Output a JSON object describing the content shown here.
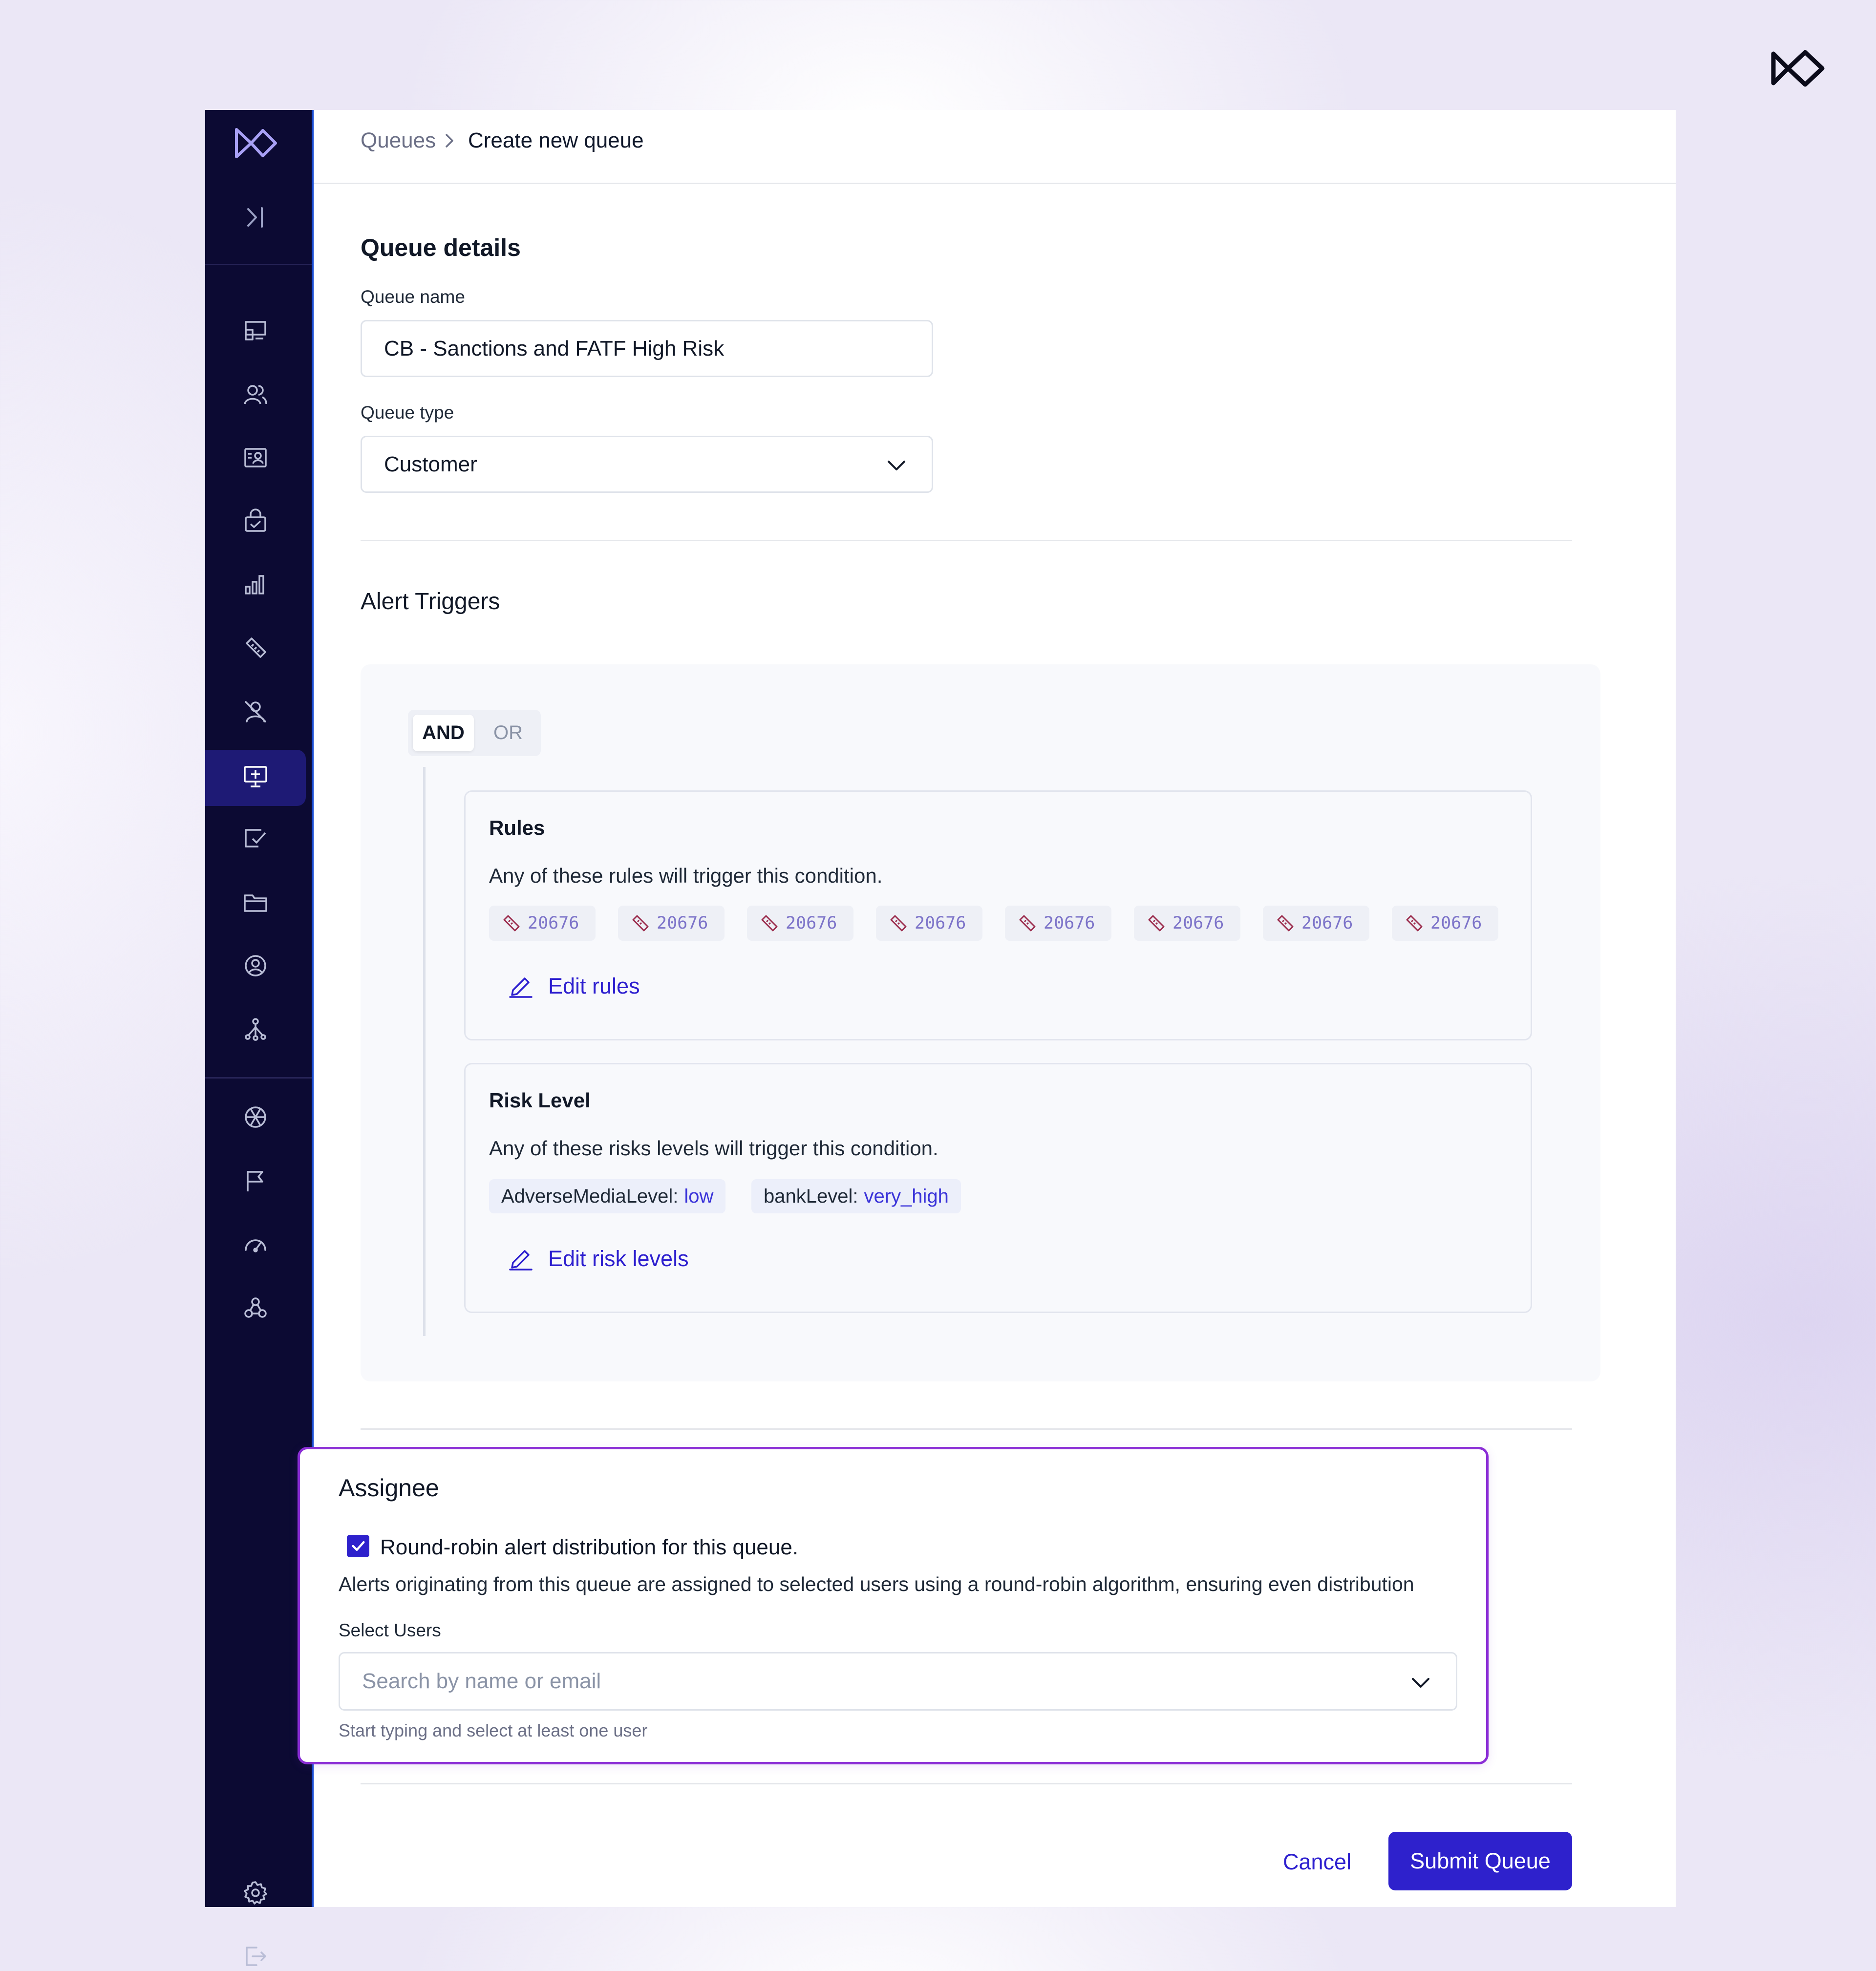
{
  "breadcrumb": {
    "parent": "Queues",
    "current": "Create new queue"
  },
  "queue_details": {
    "section_title": "Queue details",
    "name_label": "Queue name",
    "name_value": "CB - Sanctions and FATF High Risk",
    "type_label": "Queue type",
    "type_value": "Customer"
  },
  "alert_triggers": {
    "section_title": "Alert Triggers",
    "operator_and": "AND",
    "operator_or": "OR",
    "rules": {
      "title": "Rules",
      "description": "Any of these rules will trigger this condition.",
      "chips": [
        "20676",
        "20676",
        "20676",
        "20676",
        "20676",
        "20676",
        "20676",
        "20676"
      ],
      "edit_label": "Edit rules"
    },
    "risk_level": {
      "title": "Risk Level",
      "description": "Any of these risks levels will trigger this condition.",
      "chips": [
        {
          "key": "AdverseMediaLevel:",
          "value": "low"
        },
        {
          "key": "bankLevel:",
          "value": "very_high"
        }
      ],
      "edit_label": "Edit risk levels"
    }
  },
  "assignee": {
    "section_title": "Assignee",
    "checkbox_checked": true,
    "checkbox_label": "Round-robin alert distribution for this queue.",
    "description": "Alerts originating from this queue are assigned to selected users using a round-robin algorithm, ensuring even distribution",
    "select_label": "Select Users",
    "select_placeholder": "Search by name or email",
    "helper_text": "Start typing and select at least one user"
  },
  "actions": {
    "cancel_label": "Cancel",
    "submit_label": "Submit Queue"
  },
  "colors": {
    "sidebar_bg": "#0c0a33",
    "sidebar_active": "#1e1a75",
    "primary": "#2e21cc",
    "highlight_border": "#8b2ed6",
    "rule_icon": "#9b2b4c"
  },
  "icons": {
    "brand": "brand-logo-icon",
    "sidebar": [
      "dashboard-icon",
      "users-icon",
      "contact-card-icon",
      "case-lock-icon",
      "bar-chart-icon",
      "rule-tag-icon",
      "user-off-icon",
      "queue-monitor-icon",
      "review-check-icon",
      "folder-icon",
      "account-circle-icon",
      "network-icon",
      "aperture-icon",
      "flag-icon",
      "gauge-icon",
      "webhook-icon",
      "settings-icon",
      "logout-icon"
    ]
  }
}
